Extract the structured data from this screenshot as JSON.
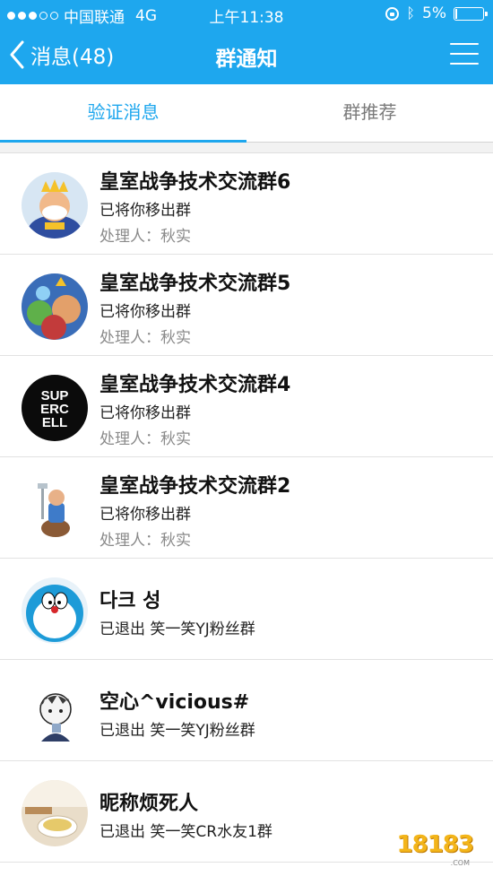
{
  "status_bar": {
    "carrier": "中国联通",
    "network": "4G",
    "time": "上午11:38",
    "battery": "5%",
    "battery_level": 0.05
  },
  "nav": {
    "back_label": "消息(48)",
    "title": "群通知"
  },
  "tabs": [
    {
      "label": "验证消息",
      "active": true
    },
    {
      "label": "群推荐",
      "active": false
    }
  ],
  "notifications": [
    {
      "title": "皇室战争技术交流群6",
      "line1": "已将你移出群",
      "line2": "处理人：秋实",
      "avatar": "king-avatar"
    },
    {
      "title": "皇室战争技术交流群5",
      "line1": "已将你移出群",
      "line2": "处理人：秋实",
      "avatar": "clash-royale-group-avatar"
    },
    {
      "title": "皇室战争技术交流群4",
      "line1": "已将你移出群",
      "line2": "处理人：秋实",
      "avatar": "supercell-logo-avatar"
    },
    {
      "title": "皇室战争技术交流群2",
      "line1": "已将你移出群",
      "line2": "处理人：秋实",
      "avatar": "knight-avatar"
    },
    {
      "title": "다크 성",
      "line1": "已退出 笑一笑YJ粉丝群",
      "avatar": "doraemon-avatar"
    },
    {
      "title": "空心^vicious#",
      "line1": "已退出 笑一笑YJ粉丝群",
      "avatar": "anime-sketch-avatar"
    },
    {
      "title": "昵称烦死人",
      "line1": "已退出 笑一笑CR水友1群",
      "avatar": "tea-cup-avatar"
    }
  ],
  "watermark": {
    "text": "18183",
    "sub": ".COM"
  },
  "colors": {
    "brand_blue": "#1ea7ee",
    "secondary_text": "#8a8a8a"
  }
}
